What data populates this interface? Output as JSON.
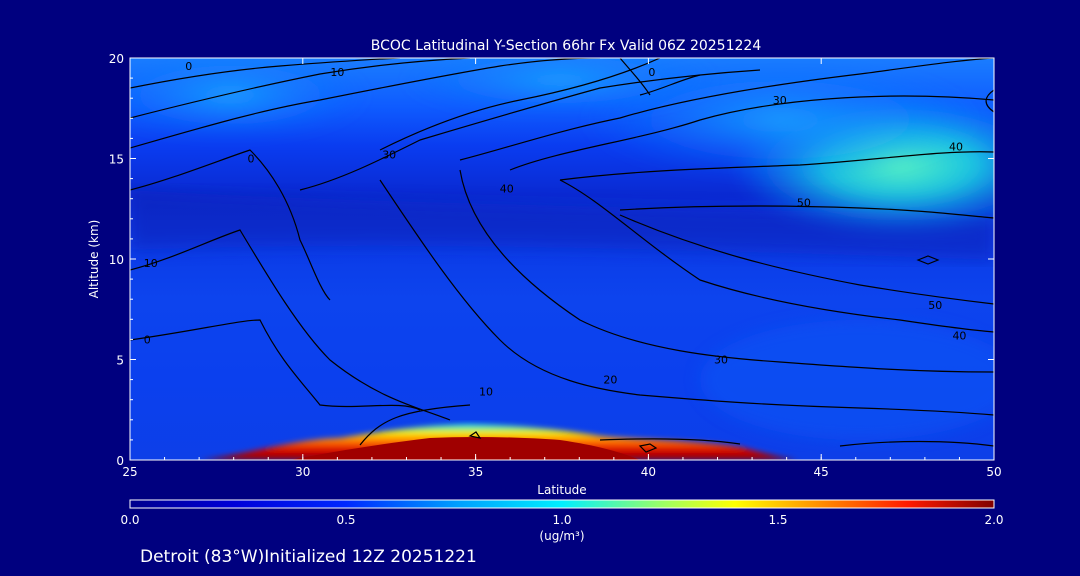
{
  "chart_data": {
    "type": "heatmap",
    "title": "BCOC Latitudinal Y-Section 66hr  Fx Valid 06Z 20251224",
    "xlabel": "Latitude",
    "ylabel": "Altitude (km)",
    "xlim": [
      25,
      50
    ],
    "ylim": [
      0,
      20
    ],
    "x_ticks": [
      "25",
      "30",
      "35",
      "40",
      "45",
      "50"
    ],
    "y_ticks": [
      "0",
      "5",
      "10",
      "15",
      "20"
    ],
    "colorbar": {
      "label": "(ug/m³)",
      "range": [
        0.0,
        2.0
      ],
      "ticks": [
        "0.0",
        "0.5",
        "1.0",
        "1.5",
        "2.0"
      ]
    },
    "contours": {
      "unit_note": "",
      "labels": [
        {
          "text": "0",
          "lat": 26.7,
          "alt": 19.6
        },
        {
          "text": "10",
          "lat": 31.0,
          "alt": 19.3
        },
        {
          "text": "0",
          "lat": 40.1,
          "alt": 19.3
        },
        {
          "text": "30",
          "lat": 43.8,
          "alt": 17.9
        },
        {
          "text": "0",
          "lat": 28.5,
          "alt": 15.0
        },
        {
          "text": "30",
          "lat": 32.5,
          "alt": 15.2
        },
        {
          "text": "40",
          "lat": 48.9,
          "alt": 15.6
        },
        {
          "text": "40",
          "lat": 35.9,
          "alt": 13.5
        },
        {
          "text": "50",
          "lat": 44.5,
          "alt": 12.8
        },
        {
          "text": "10",
          "lat": 25.6,
          "alt": 9.8
        },
        {
          "text": "50",
          "lat": 48.3,
          "alt": 7.7
        },
        {
          "text": "0",
          "lat": 25.5,
          "alt": 6.0
        },
        {
          "text": "40",
          "lat": 49.0,
          "alt": 6.2
        },
        {
          "text": "30",
          "lat": 42.1,
          "alt": 5.0
        },
        {
          "text": "20",
          "lat": 38.9,
          "alt": 4.0
        },
        {
          "text": "10",
          "lat": 35.3,
          "alt": 3.4
        }
      ]
    },
    "surface_max_region": {
      "lat_range": [
        29,
        43
      ],
      "alt_km": [
        0,
        1.2
      ],
      "peak_lat": 35.5
    }
  },
  "footer": {
    "location": "Detroit (83°W)Initialized 12Z 20251221"
  },
  "colors": {
    "background": "#00007f",
    "scale": [
      "#00008c",
      "#0000ff",
      "#00b4ff",
      "#00ffff",
      "#ffff00",
      "#ff8000",
      "#ff0000",
      "#800000"
    ]
  }
}
